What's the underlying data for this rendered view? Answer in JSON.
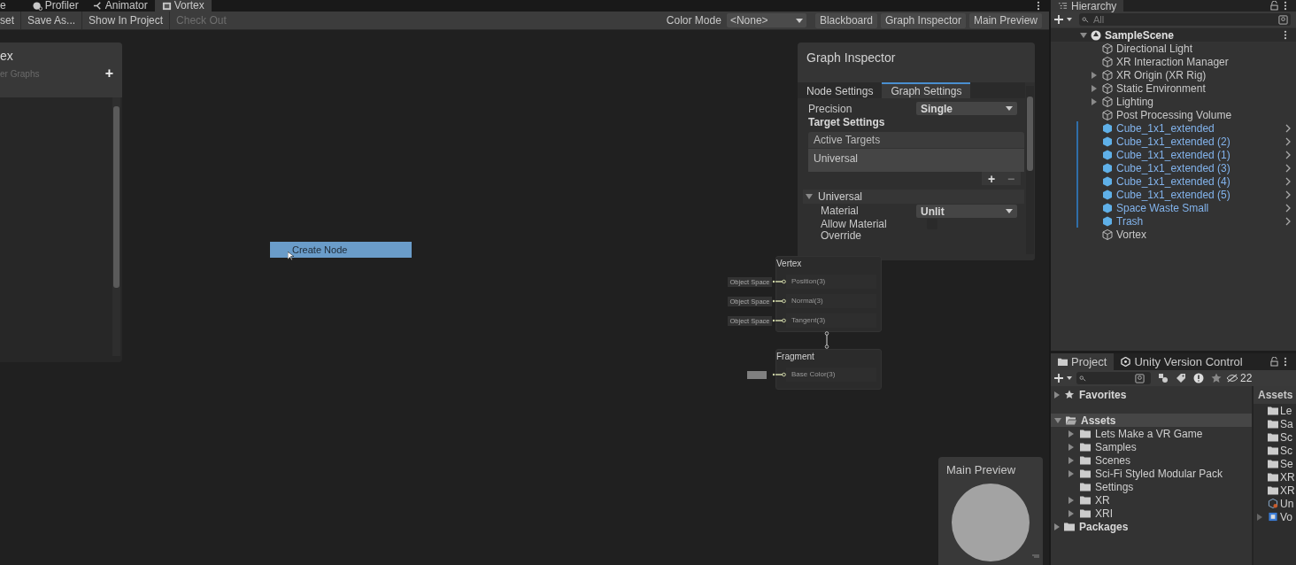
{
  "editor_tabs": [
    {
      "label": "e",
      "selected": false
    },
    {
      "label": "Profiler",
      "selected": false
    },
    {
      "label": "Animator",
      "selected": false
    },
    {
      "label": "Vortex",
      "selected": true
    }
  ],
  "toolbar": {
    "left_buttons": [
      {
        "label": "set",
        "disabled": false
      },
      {
        "label": "Save As...",
        "disabled": false
      },
      {
        "label": "Show In Project",
        "disabled": false
      },
      {
        "label": "Check Out",
        "disabled": true
      }
    ],
    "color_mode": {
      "label": "Color Mode",
      "value": "<None>"
    },
    "right_buttons": [
      "Blackboard",
      "Graph Inspector",
      "Main Preview"
    ]
  },
  "blackboard": {
    "title": "ex",
    "subtitle": "er Graphs",
    "add": "+"
  },
  "create_node": {
    "label": "Create Node"
  },
  "graph_inspector": {
    "title": "Graph Inspector",
    "tabs": [
      {
        "label": "Node Settings",
        "selected": false
      },
      {
        "label": "Graph Settings",
        "selected": true
      }
    ],
    "precision": {
      "label": "Precision",
      "value": "Single"
    },
    "target_heading": "Target Settings",
    "active_targets": {
      "header": "Active Targets",
      "items": [
        "Universal"
      ],
      "add": "+",
      "remove": "−"
    },
    "section": {
      "label": "Universal",
      "expanded": true,
      "rows": [
        {
          "kind": "dropdown",
          "label": "Material",
          "value": "Unlit"
        },
        {
          "kind": "checkbox",
          "label": "Allow Material Override",
          "checked": false
        }
      ]
    }
  },
  "nodes": [
    {
      "title": "Vertex",
      "ports": [
        {
          "kind": "space",
          "input": "Object Space",
          "label": "Position(3)"
        },
        {
          "kind": "space",
          "input": "Object Space",
          "label": "Normal(3)"
        },
        {
          "kind": "space",
          "input": "Object Space",
          "label": "Tangent(3)"
        }
      ]
    },
    {
      "title": "Fragment",
      "ports": [
        {
          "kind": "color",
          "color": "#808080",
          "label": "Base Color(3)"
        }
      ]
    }
  ],
  "main_preview": {
    "title": "Main Preview"
  },
  "hierarchy": {
    "title": "Hierarchy",
    "search_placeholder": "All",
    "scene": {
      "label": "SampleScene",
      "expanded": true,
      "children": [
        {
          "label": "Directional Light",
          "has_children": false,
          "selected": false
        },
        {
          "label": "XR Interaction Manager",
          "has_children": false,
          "selected": false
        },
        {
          "label": "XR Origin (XR Rig)",
          "has_children": true,
          "selected": false
        },
        {
          "label": "Static Environment",
          "has_children": true,
          "selected": false
        },
        {
          "label": "Lighting",
          "has_children": true,
          "selected": false
        },
        {
          "label": "Post Processing Volume",
          "has_children": false,
          "selected": false
        },
        {
          "label": "Cube_1x1_extended",
          "has_children": false,
          "selected": true
        },
        {
          "label": "Cube_1x1_extended (2)",
          "has_children": false,
          "selected": true
        },
        {
          "label": "Cube_1x1_extended (1)",
          "has_children": false,
          "selected": true
        },
        {
          "label": "Cube_1x1_extended (3)",
          "has_children": false,
          "selected": true
        },
        {
          "label": "Cube_1x1_extended (4)",
          "has_children": false,
          "selected": true
        },
        {
          "label": "Cube_1x1_extended (5)",
          "has_children": false,
          "selected": true
        },
        {
          "label": "Space Waste Small",
          "has_children": false,
          "selected": true
        },
        {
          "label": "Trash",
          "has_children": false,
          "selected": true
        },
        {
          "label": "Vortex",
          "has_children": false,
          "selected": false
        }
      ]
    }
  },
  "project": {
    "tabs": [
      {
        "label": "Project",
        "selected": true
      },
      {
        "label": "Unity Version Control",
        "selected": false
      }
    ],
    "hidden_count": "22",
    "tree": [
      {
        "label": "Favorites",
        "kind": "favorites",
        "expanded": false,
        "selected": false
      },
      {
        "label": "Assets",
        "kind": "folder",
        "expanded": true,
        "selected": true,
        "children": [
          {
            "label": "Lets Make a VR Game",
            "has_children": true
          },
          {
            "label": "Samples",
            "has_children": true
          },
          {
            "label": "Scenes",
            "has_children": true
          },
          {
            "label": "Sci-Fi Styled Modular Pack",
            "has_children": true
          },
          {
            "label": "Settings",
            "has_children": false
          },
          {
            "label": "XR",
            "has_children": true
          },
          {
            "label": "XRI",
            "has_children": true
          }
        ]
      },
      {
        "label": "Packages",
        "kind": "folder",
        "expanded": false,
        "selected": false
      }
    ],
    "grid_header": "Assets",
    "grid_items": [
      {
        "label": "Le",
        "kind": "folder"
      },
      {
        "label": "Sa",
        "kind": "folder"
      },
      {
        "label": "Sc",
        "kind": "folder"
      },
      {
        "label": "Sc",
        "kind": "folder"
      },
      {
        "label": "Se",
        "kind": "folder"
      },
      {
        "label": "XR",
        "kind": "folder"
      },
      {
        "label": "XR",
        "kind": "folder"
      },
      {
        "label": "Un",
        "kind": "package"
      },
      {
        "label": "Vo",
        "kind": "shader"
      }
    ]
  }
}
